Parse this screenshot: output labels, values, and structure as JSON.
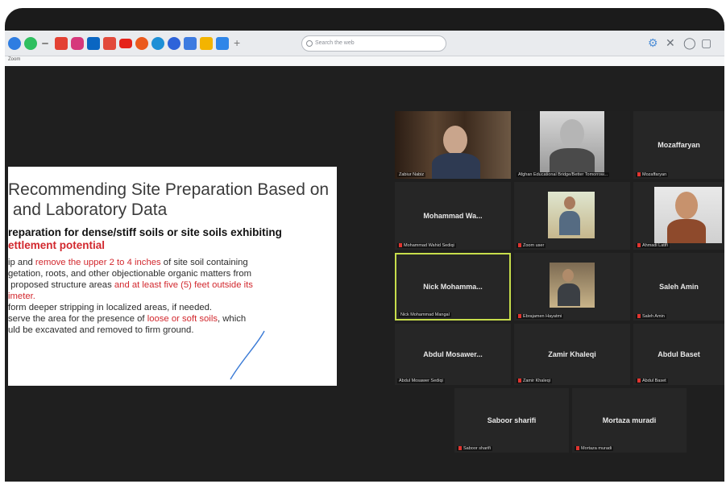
{
  "browser": {
    "search_placeholder": "Search the web",
    "page_label": "Zoom"
  },
  "slide": {
    "title": "Recommending Site Preparation Based on\n and Laboratory Data",
    "subtitle_line1": "reparation for dense/stiff soils or site soils exhibiting",
    "subtitle_line2": "ettlement potential",
    "body": [
      {
        "text": "ip and ",
        "red": false
      },
      {
        "text": "remove the upper 2 to 4 inches",
        "red": true
      },
      {
        "text": " of site soil containing\n",
        "red": false
      },
      {
        "text": "getation, roots, and other objectionable organic matters from\n",
        "red": false
      },
      {
        "text": " proposed structure areas ",
        "red": false
      },
      {
        "text": "and at least five (5) feet outside its\n",
        "red": true
      },
      {
        "text": "imeter.",
        "red": true
      },
      {
        "text": "\nform deeper stripping in localized areas, if needed.\n",
        "red": false
      },
      {
        "text": "serve the area for the presence of ",
        "red": false
      },
      {
        "text": "loose or soft soils",
        "red": true
      },
      {
        "text": ", which\nuld be excavated and removed to firm ground.",
        "red": false
      }
    ]
  },
  "participants": [
    {
      "display": "",
      "caption": "Zabiur Nabiz"
    },
    {
      "display": "",
      "caption": "Afghan Educational Bridge/Better Tomorrow..."
    },
    {
      "display": "Mozaffaryan",
      "caption": "Mozaffaryan"
    },
    {
      "display": "Mohammad Wa...",
      "caption": "Mohammad Wahid Sediqi"
    },
    {
      "display": "",
      "caption": "Zoom user"
    },
    {
      "display": "",
      "caption": "Ahmadi Latifi"
    },
    {
      "display": "Nick Mohamma...",
      "caption": "Nick Mohammad Mangal"
    },
    {
      "display": "",
      "caption": "Ebrajamen Hayatmi"
    },
    {
      "display": "Saleh Amin",
      "caption": "Saleh Amin"
    },
    {
      "display": "Abdul Mosawer...",
      "caption": "Abdul Mosawer Sediqi"
    },
    {
      "display": "Zamir Khaleqi",
      "caption": "Zamir Khaleqi"
    },
    {
      "display": "Abdul Baset",
      "caption": "Abdul Baset"
    },
    {
      "display": "Saboor sharifi",
      "caption": "Saboor sharifi"
    },
    {
      "display": "Mortaza muradi",
      "caption": "Mortaza muradi"
    }
  ]
}
